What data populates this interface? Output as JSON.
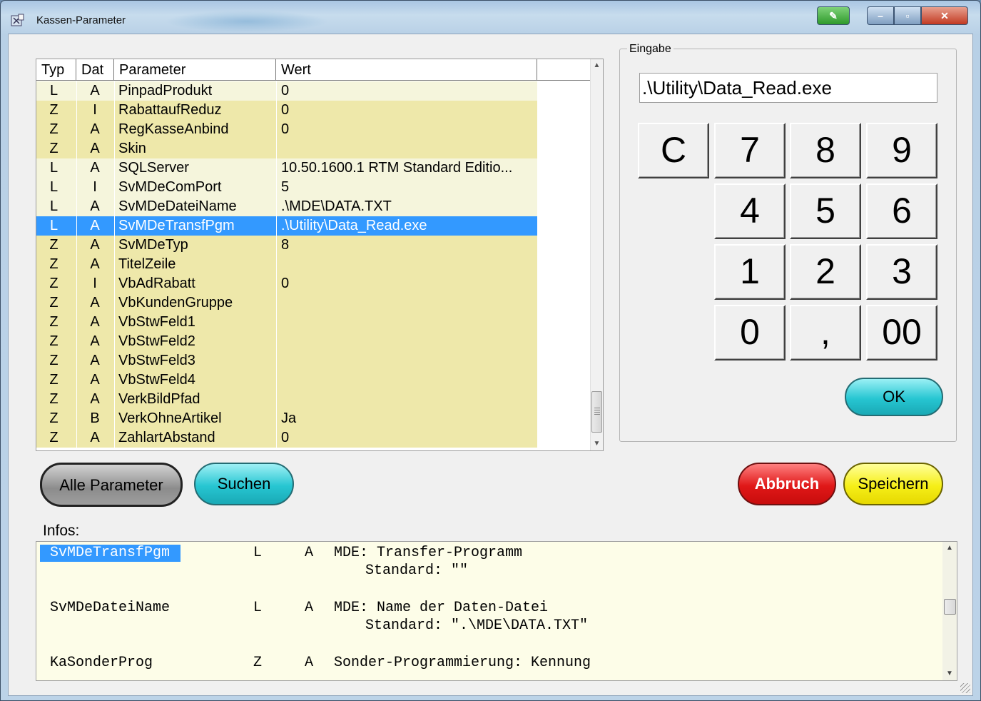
{
  "window": {
    "title": "Kassen-Parameter"
  },
  "grid": {
    "headers": {
      "typ": "Typ",
      "dat": "Dat",
      "parameter": "Parameter",
      "wert": "Wert"
    },
    "rows": [
      {
        "typ": "L",
        "dat": "A",
        "parameter": "PinpadProdukt",
        "wert": "0",
        "tone": "light"
      },
      {
        "typ": "Z",
        "dat": "I",
        "parameter": "RabattaufReduz",
        "wert": "0",
        "tone": "dark"
      },
      {
        "typ": "Z",
        "dat": "A",
        "parameter": "RegKasseAnbind",
        "wert": "0",
        "tone": "dark"
      },
      {
        "typ": "Z",
        "dat": "A",
        "parameter": "Skin",
        "wert": "",
        "tone": "dark"
      },
      {
        "typ": "L",
        "dat": "A",
        "parameter": "SQLServer",
        "wert": "10.50.1600.1  RTM Standard Editio...",
        "tone": "light"
      },
      {
        "typ": "L",
        "dat": "I",
        "parameter": "SvMDeComPort",
        "wert": "5",
        "tone": "light"
      },
      {
        "typ": "L",
        "dat": "A",
        "parameter": "SvMDeDateiName",
        "wert": ".\\MDE\\DATA.TXT",
        "tone": "light"
      },
      {
        "typ": "L",
        "dat": "A",
        "parameter": "SvMDeTransfPgm",
        "wert": ".\\Utility\\Data_Read.exe",
        "tone": "selected"
      },
      {
        "typ": "Z",
        "dat": "A",
        "parameter": "SvMDeTyp",
        "wert": "8",
        "tone": "dark"
      },
      {
        "typ": "Z",
        "dat": "A",
        "parameter": "TitelZeile",
        "wert": "",
        "tone": "dark"
      },
      {
        "typ": "Z",
        "dat": "I",
        "parameter": "VbAdRabatt",
        "wert": "0",
        "tone": "dark"
      },
      {
        "typ": "Z",
        "dat": "A",
        "parameter": "VbKundenGruppe",
        "wert": "",
        "tone": "dark"
      },
      {
        "typ": "Z",
        "dat": "A",
        "parameter": "VbStwFeld1",
        "wert": "",
        "tone": "dark"
      },
      {
        "typ": "Z",
        "dat": "A",
        "parameter": "VbStwFeld2",
        "wert": "",
        "tone": "dark"
      },
      {
        "typ": "Z",
        "dat": "A",
        "parameter": "VbStwFeld3",
        "wert": "",
        "tone": "dark"
      },
      {
        "typ": "Z",
        "dat": "A",
        "parameter": "VbStwFeld4",
        "wert": "",
        "tone": "dark"
      },
      {
        "typ": "Z",
        "dat": "A",
        "parameter": "VerkBildPfad",
        "wert": "",
        "tone": "dark"
      },
      {
        "typ": "Z",
        "dat": "B",
        "parameter": "VerkOhneArtikel",
        "wert": "Ja",
        "tone": "dark"
      },
      {
        "typ": "Z",
        "dat": "A",
        "parameter": "ZahlartAbstand",
        "wert": "0",
        "tone": "dark"
      }
    ],
    "colors": {
      "light": "#f5f5dc",
      "dark": "#eee8aa",
      "selected": "#3399ff"
    }
  },
  "eingabe": {
    "group_label": "Eingabe",
    "value": ".\\Utility\\Data_Read.exe",
    "keys": [
      "C",
      "7",
      "8",
      "9",
      "4",
      "5",
      "6",
      "1",
      "2",
      "3",
      "0",
      ",",
      "00"
    ],
    "ok_label": "OK"
  },
  "buttons": {
    "alle_parameter": "Alle Parameter",
    "suchen": "Suchen",
    "abbruch": "Abbruch",
    "speichern": "Speichern"
  },
  "infos": {
    "label": "Infos:",
    "lines": [
      {
        "name": "SvMDeTransfPgm",
        "typ": "L",
        "dat": "A",
        "desc": "MDE: Transfer-Programm",
        "std": "Standard: \"\""
      },
      {
        "name": "SvMDeDateiName",
        "typ": "L",
        "dat": "A",
        "desc": "MDE: Name der Daten-Datei",
        "std": "Standard: \".\\MDE\\DATA.TXT\""
      },
      {
        "name": "KaSonderProg",
        "typ": "Z",
        "dat": "A",
        "desc": "Sonder-Programmierung: Kennung",
        "std": ""
      }
    ]
  }
}
